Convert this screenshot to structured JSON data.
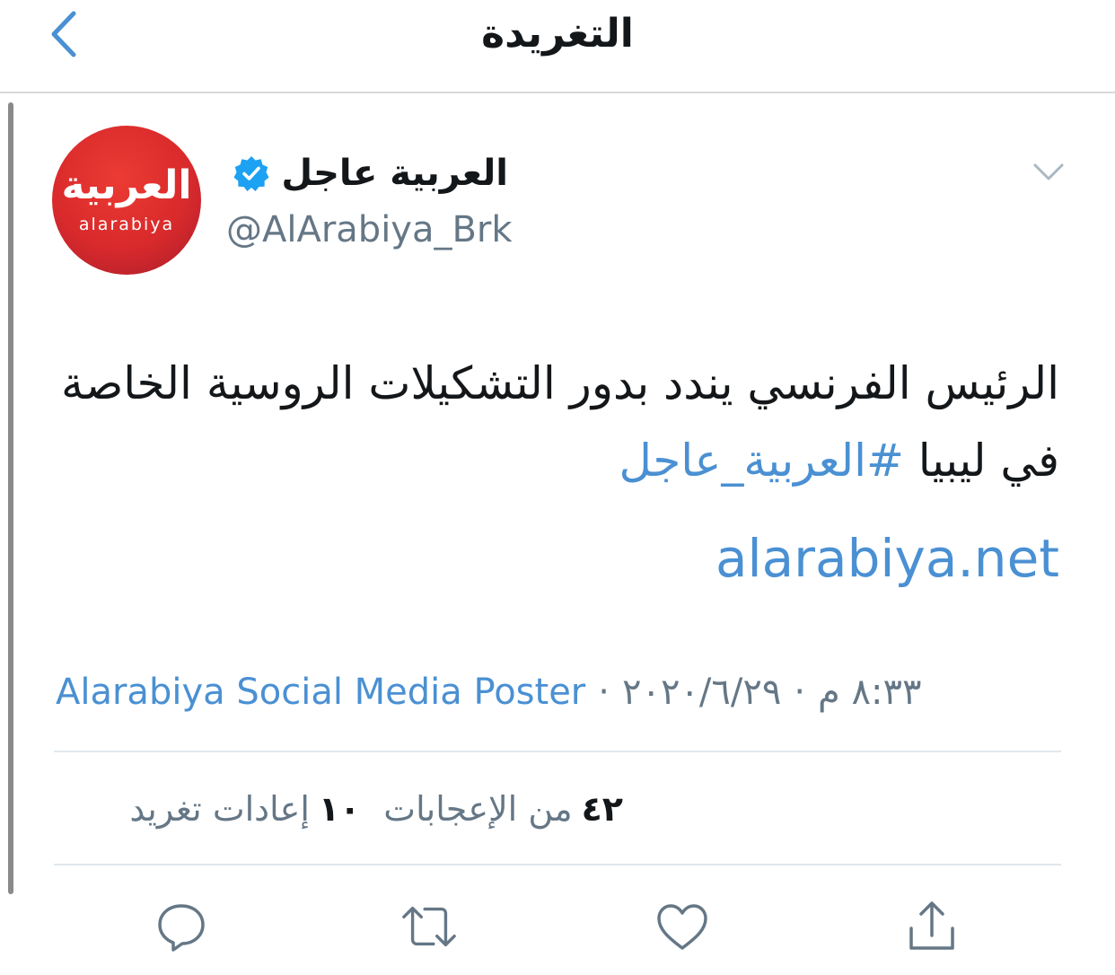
{
  "header": {
    "title": "التغريدة",
    "back_icon": "chevron-left-icon"
  },
  "tweet": {
    "display_name": "العربية عاجل",
    "handle": "@AlArabiya_Brk",
    "verified": true,
    "avatar": {
      "arabic_logo": "العربية",
      "latin_logo": "alarabiya"
    },
    "text": "الرئيس الفرنسي يندد بدور التشكيلات الروسية الخاصة في ليبيا",
    "hashtag": "#العربية_عاجل",
    "link": "alarabiya.net",
    "time": "٨:٣٣ م",
    "date": "٢٠٢٠/٦/٢٩",
    "separator": "·",
    "source": "Alarabiya Social Media Poster",
    "likes_count": "٤٢",
    "likes_label": "من الإعجابات",
    "retweets_count": "١٠",
    "retweets_label": "إعادات تغريد"
  },
  "colors": {
    "link": "#4a90d3",
    "secondary_text": "#657786",
    "avatar_red": "#d92a2c",
    "verified_blue": "#1da1f2"
  },
  "actions": [
    "reply-icon",
    "retweet-icon",
    "like-icon",
    "share-icon"
  ]
}
